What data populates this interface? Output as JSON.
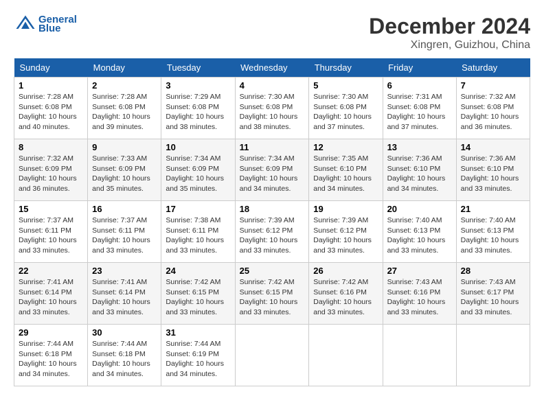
{
  "header": {
    "logo_text_general": "General",
    "logo_text_blue": "Blue",
    "month_title": "December 2024",
    "location": "Xingren, Guizhou, China"
  },
  "weekdays": [
    "Sunday",
    "Monday",
    "Tuesday",
    "Wednesday",
    "Thursday",
    "Friday",
    "Saturday"
  ],
  "weeks": [
    [
      {
        "day": "1",
        "sunrise": "7:28 AM",
        "sunset": "6:08 PM",
        "daylight": "10 hours and 40 minutes."
      },
      {
        "day": "2",
        "sunrise": "7:28 AM",
        "sunset": "6:08 PM",
        "daylight": "10 hours and 39 minutes."
      },
      {
        "day": "3",
        "sunrise": "7:29 AM",
        "sunset": "6:08 PM",
        "daylight": "10 hours and 38 minutes."
      },
      {
        "day": "4",
        "sunrise": "7:30 AM",
        "sunset": "6:08 PM",
        "daylight": "10 hours and 38 minutes."
      },
      {
        "day": "5",
        "sunrise": "7:30 AM",
        "sunset": "6:08 PM",
        "daylight": "10 hours and 37 minutes."
      },
      {
        "day": "6",
        "sunrise": "7:31 AM",
        "sunset": "6:08 PM",
        "daylight": "10 hours and 37 minutes."
      },
      {
        "day": "7",
        "sunrise": "7:32 AM",
        "sunset": "6:08 PM",
        "daylight": "10 hours and 36 minutes."
      }
    ],
    [
      {
        "day": "8",
        "sunrise": "7:32 AM",
        "sunset": "6:09 PM",
        "daylight": "10 hours and 36 minutes."
      },
      {
        "day": "9",
        "sunrise": "7:33 AM",
        "sunset": "6:09 PM",
        "daylight": "10 hours and 35 minutes."
      },
      {
        "day": "10",
        "sunrise": "7:34 AM",
        "sunset": "6:09 PM",
        "daylight": "10 hours and 35 minutes."
      },
      {
        "day": "11",
        "sunrise": "7:34 AM",
        "sunset": "6:09 PM",
        "daylight": "10 hours and 34 minutes."
      },
      {
        "day": "12",
        "sunrise": "7:35 AM",
        "sunset": "6:10 PM",
        "daylight": "10 hours and 34 minutes."
      },
      {
        "day": "13",
        "sunrise": "7:36 AM",
        "sunset": "6:10 PM",
        "daylight": "10 hours and 34 minutes."
      },
      {
        "day": "14",
        "sunrise": "7:36 AM",
        "sunset": "6:10 PM",
        "daylight": "10 hours and 33 minutes."
      }
    ],
    [
      {
        "day": "15",
        "sunrise": "7:37 AM",
        "sunset": "6:11 PM",
        "daylight": "10 hours and 33 minutes."
      },
      {
        "day": "16",
        "sunrise": "7:37 AM",
        "sunset": "6:11 PM",
        "daylight": "10 hours and 33 minutes."
      },
      {
        "day": "17",
        "sunrise": "7:38 AM",
        "sunset": "6:11 PM",
        "daylight": "10 hours and 33 minutes."
      },
      {
        "day": "18",
        "sunrise": "7:39 AM",
        "sunset": "6:12 PM",
        "daylight": "10 hours and 33 minutes."
      },
      {
        "day": "19",
        "sunrise": "7:39 AM",
        "sunset": "6:12 PM",
        "daylight": "10 hours and 33 minutes."
      },
      {
        "day": "20",
        "sunrise": "7:40 AM",
        "sunset": "6:13 PM",
        "daylight": "10 hours and 33 minutes."
      },
      {
        "day": "21",
        "sunrise": "7:40 AM",
        "sunset": "6:13 PM",
        "daylight": "10 hours and 33 minutes."
      }
    ],
    [
      {
        "day": "22",
        "sunrise": "7:41 AM",
        "sunset": "6:14 PM",
        "daylight": "10 hours and 33 minutes."
      },
      {
        "day": "23",
        "sunrise": "7:41 AM",
        "sunset": "6:14 PM",
        "daylight": "10 hours and 33 minutes."
      },
      {
        "day": "24",
        "sunrise": "7:42 AM",
        "sunset": "6:15 PM",
        "daylight": "10 hours and 33 minutes."
      },
      {
        "day": "25",
        "sunrise": "7:42 AM",
        "sunset": "6:15 PM",
        "daylight": "10 hours and 33 minutes."
      },
      {
        "day": "26",
        "sunrise": "7:42 AM",
        "sunset": "6:16 PM",
        "daylight": "10 hours and 33 minutes."
      },
      {
        "day": "27",
        "sunrise": "7:43 AM",
        "sunset": "6:16 PM",
        "daylight": "10 hours and 33 minutes."
      },
      {
        "day": "28",
        "sunrise": "7:43 AM",
        "sunset": "6:17 PM",
        "daylight": "10 hours and 33 minutes."
      }
    ],
    [
      {
        "day": "29",
        "sunrise": "7:44 AM",
        "sunset": "6:18 PM",
        "daylight": "10 hours and 34 minutes."
      },
      {
        "day": "30",
        "sunrise": "7:44 AM",
        "sunset": "6:18 PM",
        "daylight": "10 hours and 34 minutes."
      },
      {
        "day": "31",
        "sunrise": "7:44 AM",
        "sunset": "6:19 PM",
        "daylight": "10 hours and 34 minutes."
      },
      null,
      null,
      null,
      null
    ]
  ],
  "labels": {
    "sunrise_label": "Sunrise:",
    "sunset_label": "Sunset:",
    "daylight_label": "Daylight:"
  }
}
